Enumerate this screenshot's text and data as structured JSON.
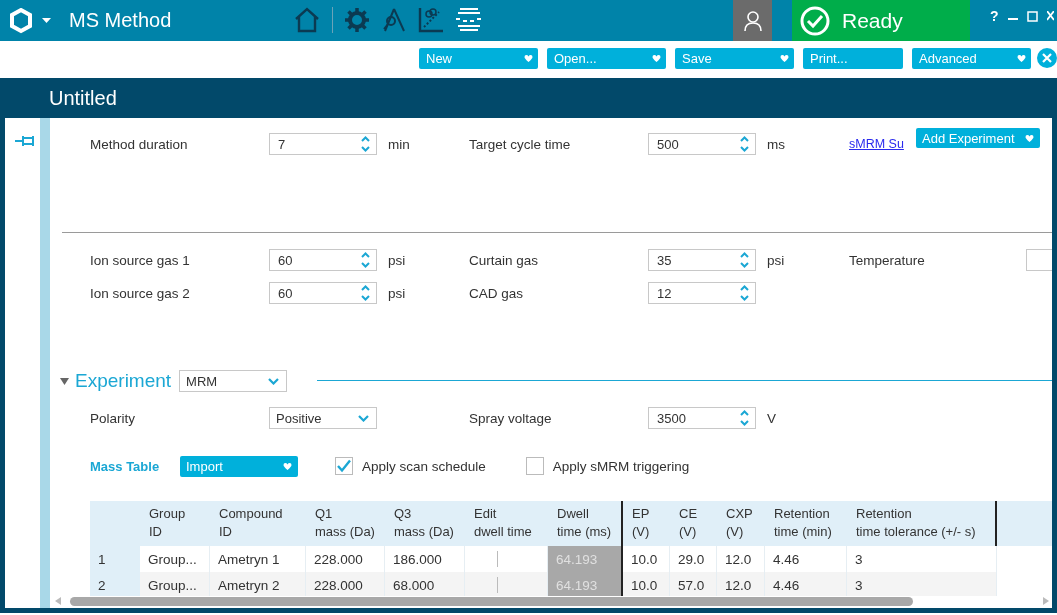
{
  "window": {
    "title": "MS Method",
    "help": "?"
  },
  "status": {
    "text": "Ready"
  },
  "menu_buttons": [
    {
      "label": "New",
      "dropdown": true
    },
    {
      "label": "Open...",
      "dropdown": true
    },
    {
      "label": "Save",
      "dropdown": true
    },
    {
      "label": "Print...",
      "dropdown": false
    },
    {
      "label": "Advanced",
      "dropdown": true
    }
  ],
  "document": {
    "title": "Untitled",
    "pinned": true
  },
  "timing": {
    "fields": [
      {
        "label": "Method duration",
        "value": "7",
        "unit": "min"
      },
      {
        "label": "Target cycle time",
        "value": "500",
        "unit": "ms"
      }
    ],
    "link": "sMRM Su",
    "add_button": "Add Experiment"
  },
  "source_rows": [
    [
      {
        "label": "Ion source gas 1",
        "value": "60",
        "unit": "psi"
      },
      {
        "label": "Curtain gas",
        "value": "35",
        "unit": "psi"
      },
      {
        "label": "Temperature"
      }
    ],
    [
      {
        "label": "Ion source gas 2",
        "value": "60",
        "unit": "psi"
      },
      {
        "label": "CAD gas",
        "value": "12"
      }
    ]
  ],
  "experiment": {
    "title": "Experiment",
    "expanded": true,
    "type": "MRM",
    "polarity": {
      "label": "Polarity",
      "value": "Positive"
    },
    "spray": {
      "label": "Spray voltage",
      "value": "3500",
      "unit": "V"
    },
    "mass_table_label": "Mass Table",
    "import_button": "Import",
    "checkboxes": [
      {
        "label": "Apply scan schedule",
        "checked": true
      },
      {
        "label": "Apply sMRM triggering",
        "checked": false
      }
    ]
  },
  "table": {
    "columns": [
      {
        "label": "Group\nID",
        "kind": "text"
      },
      {
        "label": "Compound\nID",
        "kind": "text"
      },
      {
        "label": "Q1\nmass (Da)",
        "kind": "text"
      },
      {
        "label": "Q3\nmass (Da)",
        "kind": "text"
      },
      {
        "label": "Edit\ndwell time",
        "kind": "edit"
      },
      {
        "label": "Dwell\ntime (ms)",
        "kind": "readonly"
      },
      {
        "label": "EP\n(V)",
        "kind": "text"
      },
      {
        "label": "CE\n(V)",
        "kind": "text"
      },
      {
        "label": "CXP\n(V)",
        "kind": "text"
      },
      {
        "label": "Retention\ntime (min)",
        "kind": "text"
      },
      {
        "label": "Retention\ntime tolerance (+/- s)",
        "kind": "text"
      }
    ],
    "rows": [
      {
        "number": "1",
        "cells": [
          "Group...",
          "Ametryn 1",
          "228.000",
          "186.000",
          "",
          "64.193",
          "10.0",
          "29.0",
          "12.0",
          "4.46",
          "3"
        ]
      },
      {
        "number": "2",
        "cells": [
          "Group...",
          "Ametryn 2",
          "228.000",
          "68.000",
          "",
          "64.193",
          "10.0",
          "57.0",
          "12.0",
          "4.46",
          "3"
        ]
      }
    ]
  }
}
